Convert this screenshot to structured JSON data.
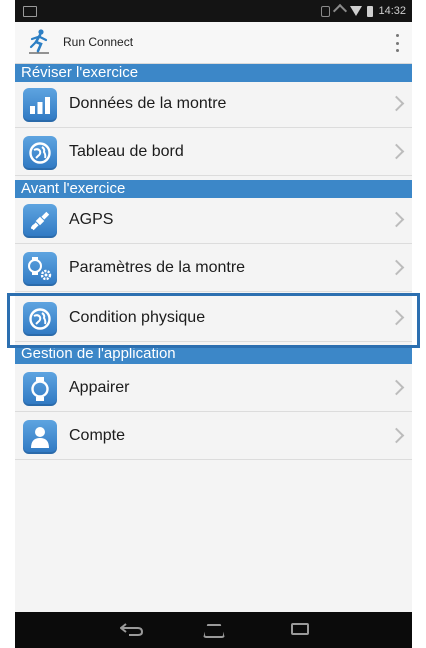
{
  "status_bar": {
    "time": "14:32"
  },
  "app_bar": {
    "title": "Run Connect"
  },
  "sections": [
    {
      "title": "Réviser l'exercice"
    },
    {
      "title": "Avant l'exercice"
    },
    {
      "title": "Gestion de l'application"
    }
  ],
  "items": [
    {
      "label": "Données de la montre",
      "icon": "bar-chart-icon"
    },
    {
      "label": "Tableau de bord",
      "icon": "dashboard-globe-icon"
    },
    {
      "label": "AGPS",
      "icon": "satellite-icon"
    },
    {
      "label": "Paramètres de la montre",
      "icon": "watch-settings-icon"
    },
    {
      "label": "Condition physique",
      "icon": "fitness-globe-icon"
    },
    {
      "label": "Appairer",
      "icon": "watch-pair-icon"
    },
    {
      "label": "Compte",
      "icon": "user-icon"
    }
  ],
  "colors": {
    "section_header": "#3c87c8",
    "highlight": "#2c6fb0",
    "icon_tile": "#3f8bd3"
  }
}
